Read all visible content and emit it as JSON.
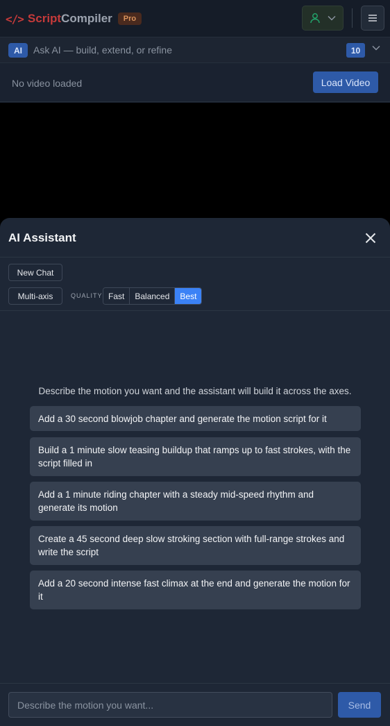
{
  "header": {
    "logo_mark": "</>",
    "logo_script": "Script",
    "logo_compiler": "Compiler",
    "plan_badge": "Pro"
  },
  "ask_bar": {
    "chip": "AI",
    "placeholder": "Ask AI — build, extend, or refine",
    "count": "10"
  },
  "video": {
    "status": "No video loaded",
    "load_button": "Load Video"
  },
  "assistant": {
    "title": "AI Assistant",
    "new_chat": "New Chat",
    "multi_axis": "Multi-axis",
    "quality_label": "QUALITY",
    "quality_options": [
      "Fast",
      "Balanced",
      "Best"
    ],
    "quality_selected": "Best",
    "intro": "Describe the motion you want and the assistant will build it across the axes.",
    "suggestions": [
      "Add a 30 second blowjob chapter and generate the motion script for it",
      "Build a 1 minute slow teasing buildup that ramps up to fast strokes, with the script filled in",
      "Add a 1 minute riding chapter with a steady mid-speed rhythm and generate its motion",
      "Create a 45 second deep slow stroking section with full-range strokes and write the script",
      "Add a 20 second intense fast climax at the end and generate the motion for it"
    ],
    "input_placeholder": "Describe the motion you want...",
    "send": "Send"
  },
  "colors": {
    "accent": "#2e5aa8",
    "active_segment": "#3b82f6",
    "brand_red": "#c53a3a"
  }
}
